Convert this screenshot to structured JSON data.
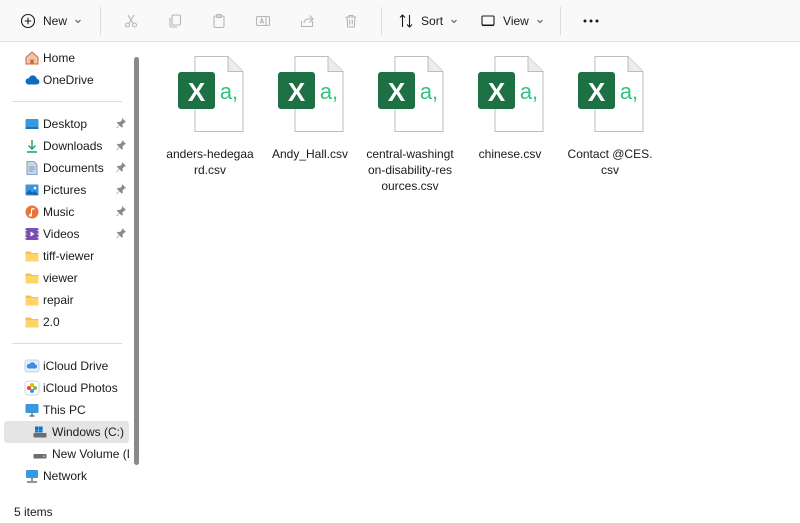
{
  "toolbar": {
    "new_label": "New",
    "sort_label": "Sort",
    "view_label": "View"
  },
  "sidebar": {
    "quick": [
      {
        "label": "Home",
        "icon": "home-icon"
      },
      {
        "label": "OneDrive",
        "icon": "cloud-icon"
      }
    ],
    "pinned": [
      {
        "label": "Desktop",
        "icon": "desktop-icon"
      },
      {
        "label": "Downloads",
        "icon": "download-icon"
      },
      {
        "label": "Documents",
        "icon": "document-icon"
      },
      {
        "label": "Pictures",
        "icon": "pictures-icon"
      },
      {
        "label": "Music",
        "icon": "music-icon"
      },
      {
        "label": "Videos",
        "icon": "video-icon"
      }
    ],
    "folders": [
      {
        "label": "tiff-viewer"
      },
      {
        "label": "viewer"
      },
      {
        "label": "repair"
      },
      {
        "label": "2.0"
      }
    ],
    "devices": [
      {
        "label": "iCloud Drive"
      },
      {
        "label": "iCloud Photos"
      },
      {
        "label": "This PC"
      },
      {
        "label": "Windows (C:)"
      },
      {
        "label": "New Volume (D:"
      },
      {
        "label": "Network"
      }
    ]
  },
  "files": [
    {
      "name": "anders-hedegaard.csv"
    },
    {
      "name": "Andy_Hall.csv"
    },
    {
      "name": "central-washington-disability-resources.csv"
    },
    {
      "name": "chinese.csv"
    },
    {
      "name": "Contact @CES.csv"
    }
  ],
  "file_icon": {
    "letter": "X",
    "glyph": "a,",
    "brand_color": "#1d7044",
    "accent_color": "#33c481"
  },
  "status": {
    "item_count": "5 items"
  }
}
